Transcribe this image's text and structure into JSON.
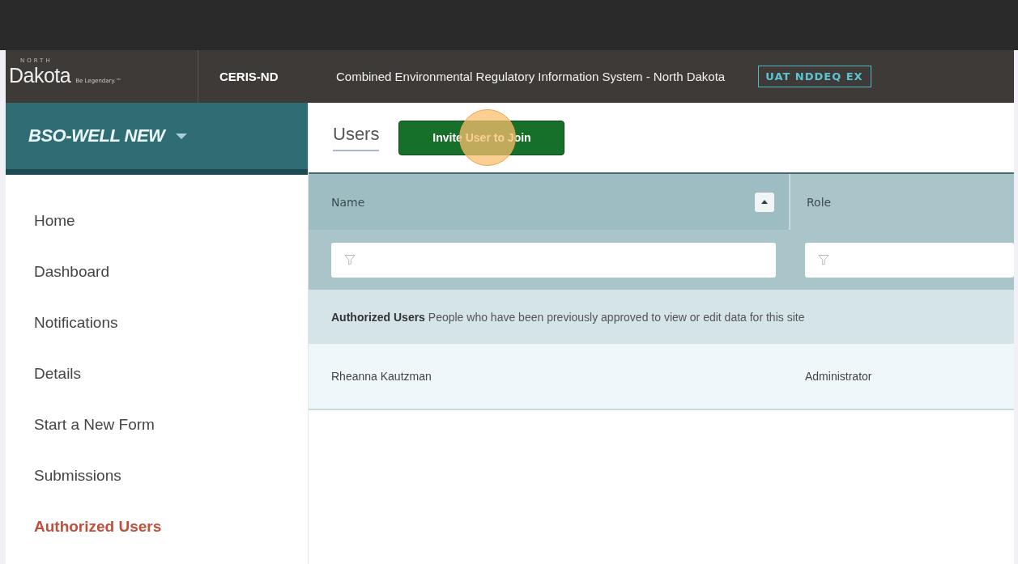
{
  "header": {
    "logo": {
      "small": "NORTH",
      "main": "Dakota",
      "tagline": "Be Legendary.™"
    },
    "app_name": "CERIS-ND",
    "app_title": "Combined Environmental Regulatory Information System - North Dakota",
    "environment_badge": "UAT NDDEQ EX"
  },
  "site_selector": {
    "label": "BSO-WELL NEW"
  },
  "sidebar": {
    "items": [
      {
        "label": "Home",
        "selected": false
      },
      {
        "label": "Dashboard",
        "selected": false
      },
      {
        "label": "Notifications",
        "selected": false
      },
      {
        "label": "Details",
        "selected": false
      },
      {
        "label": "Start a New Form",
        "selected": false
      },
      {
        "label": "Submissions",
        "selected": false
      },
      {
        "label": "Authorized Users",
        "selected": true
      }
    ]
  },
  "page": {
    "tab": {
      "label": "Users",
      "selected": true
    },
    "invite_button": "Invite User to Join",
    "click_indicator": true
  },
  "table": {
    "columns": [
      {
        "label": "Name",
        "sorted": true
      },
      {
        "label": "Role",
        "sorted": false
      }
    ],
    "group": {
      "title": "Authorized Users",
      "description": "People who have been previously approved to view or edit data for this site"
    },
    "rows": [
      {
        "cells": [
          "Rheanna Kautzman",
          "Administrator"
        ]
      }
    ]
  }
}
